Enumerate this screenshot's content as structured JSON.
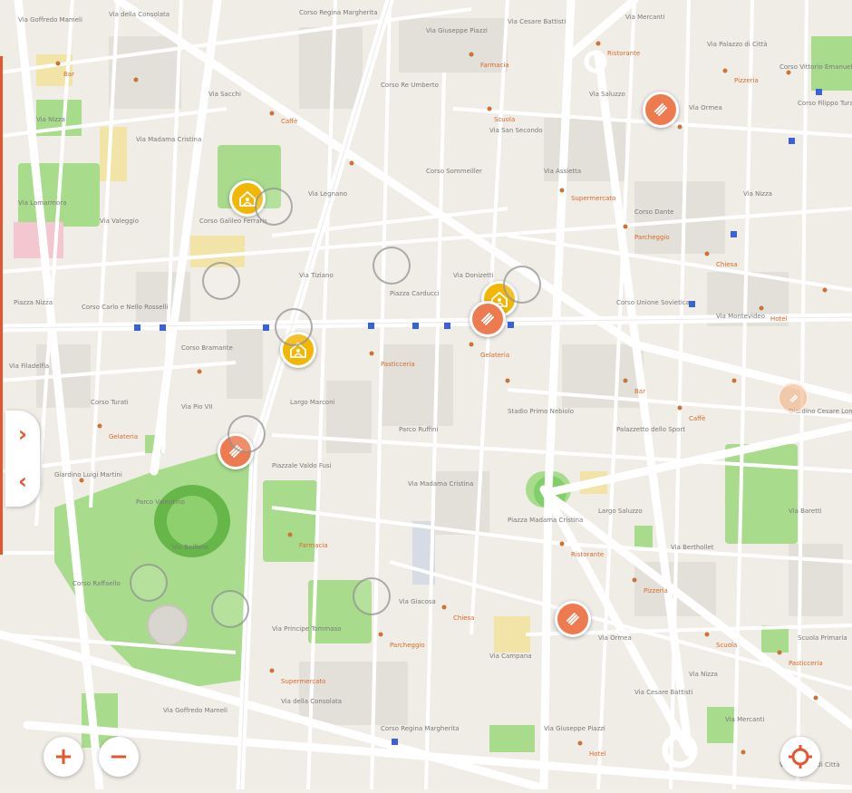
{
  "map": {
    "street_labels": [
      "Via Goffredo Mameli",
      "Via della Consolata",
      "Corso Regina Margherita",
      "Via Giuseppe Piazzi",
      "Via Cesare Battisti",
      "Via Mercanti",
      "Via Palazzo di Città",
      "Corso Vittorio Emanuele II",
      "Via Nizza",
      "Via Madama Cristina",
      "Via Sacchi",
      "Corso Re Umberto",
      "Via San Secondo",
      "Via Saluzzo",
      "Via Ormea",
      "Corso Filippo Turati",
      "Via Lamarmora",
      "Via Valeggio",
      "Corso Galileo Ferraris",
      "Via Legnano",
      "Corso Sommeiller",
      "Via Assietta",
      "Corso Dante",
      "Via Nizza",
      "Piazza Nizza",
      "Corso Carlo e Nello Rosselli",
      "Corso Bramante",
      "Via Tiziano",
      "Piazza Carducci",
      "Via Donizetti",
      "Corso Unione Sovietica",
      "Via Montevideo",
      "Via Filadelfia",
      "Corso Turati",
      "Via Pio VII",
      "Largo Marconi",
      "Parco Ruffini",
      "Stadio Primo Nebiolo",
      "Palazzetto dello Sport",
      "Giardino Cesare Lombroso",
      "Giardino Luigi Martini",
      "Parco Valentino",
      "Piazzale Valdo Fusi",
      "Via Madama Cristina",
      "Piazza Madama Cristina",
      "Largo Saluzzo",
      "Via Berthollet",
      "Via Baretti",
      "Corso Raffaello",
      "Via Belfiore",
      "Via Principe Tommaso",
      "Via Giacosa",
      "Via Campana",
      "Via Ormea",
      "Via Nizza",
      "Scuola Primaria"
    ],
    "poi_labels": [
      "Bar",
      "Caffè",
      "Farmacia",
      "Ristorante",
      "Pizzeria",
      "Scuola",
      "Supermercato",
      "Parcheggio",
      "Chiesa",
      "Hotel",
      "Pasticceria",
      "Gelateria"
    ]
  },
  "markers": [
    {
      "type": "yellow",
      "icon": "child-care-icon"
    },
    {
      "type": "yellow",
      "icon": "child-care-icon"
    },
    {
      "type": "yellow",
      "icon": "child-care-icon"
    },
    {
      "type": "orange",
      "icon": "health-icon"
    },
    {
      "type": "orange",
      "icon": "health-icon"
    },
    {
      "type": "orange",
      "icon": "health-icon"
    },
    {
      "type": "orange",
      "icon": "health-icon"
    }
  ],
  "controls": {
    "expand_label": "›",
    "collapse_label": "‹",
    "zoom_in_label": "+",
    "zoom_out_label": "−",
    "locate_icon": "crosshair-icon"
  },
  "colors": {
    "accent": "#e4572e",
    "marker_yellow": "#f2b705",
    "marker_orange": "#ee7b50",
    "park": "#a8dc8c",
    "road": "#ffffff",
    "background": "#f2efe9"
  }
}
